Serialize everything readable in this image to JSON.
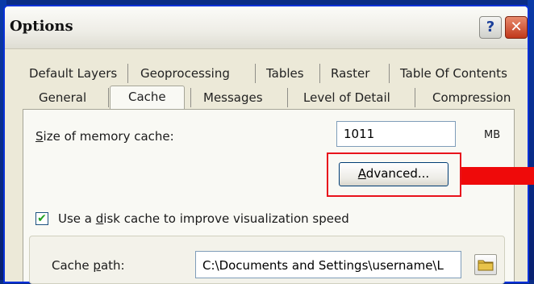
{
  "window": {
    "title": "Options",
    "help_glyph": "?",
    "close_glyph": "✕"
  },
  "tabs_row1": [
    "Default Layers",
    "Geoprocessing",
    "Tables",
    "Raster",
    "Table Of Contents"
  ],
  "tabs_row2": [
    "General",
    "Cache",
    "Messages",
    "Level of Detail",
    "Compression"
  ],
  "active_tab": "Cache",
  "memory_cache": {
    "label_prefix": "S",
    "label_rest": "ize of memory cache:",
    "value": "1011",
    "unit": "MB"
  },
  "advanced_button": {
    "prefix": "",
    "underlined": "A",
    "rest": "dvanced..."
  },
  "disk_cache": {
    "checked": true,
    "label_a": "Use a ",
    "label_u": "d",
    "label_b": "isk cache to improve visualization speed"
  },
  "cache_path": {
    "label_a": "Cache ",
    "label_u": "p",
    "label_b": "ath:",
    "value": "C:\\Documents and Settings\\username\\L"
  },
  "colors": {
    "highlight": "#e8131c",
    "arrow": "#ef0a0a",
    "desktop": "#0a2c86"
  }
}
